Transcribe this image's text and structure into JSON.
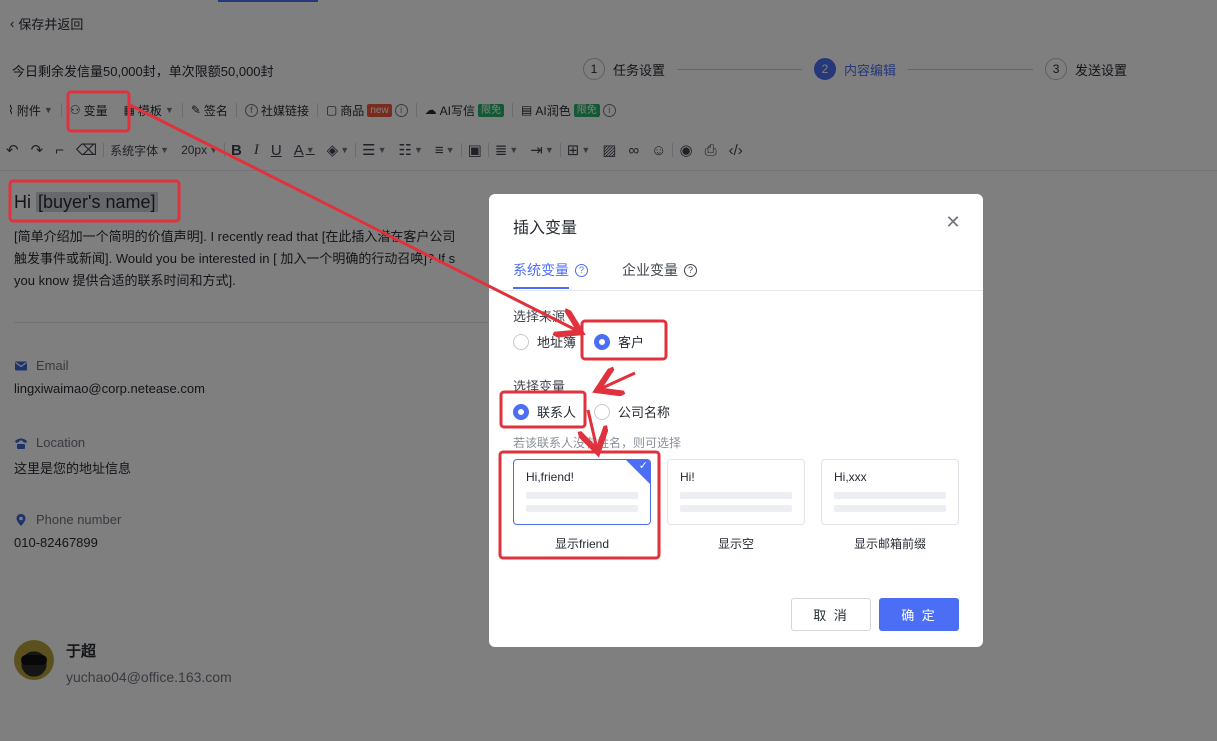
{
  "header": {
    "back_label": "保存并返回",
    "quota": "今日剩余发信量50,000封，单次限额50,000封"
  },
  "steps": [
    {
      "num": "1",
      "label": "任务设置"
    },
    {
      "num": "2",
      "label": "内容编辑"
    },
    {
      "num": "3",
      "label": "发送设置"
    }
  ],
  "toolbar1": {
    "attachment": "附件",
    "variable": "变量",
    "template": "模板",
    "signature": "签名",
    "social_link": "社媒链接",
    "product": "商品",
    "new_tag": "new",
    "ai_write": "AI写信",
    "ai_polish": "AI润色",
    "free_tag": "限免"
  },
  "toolbar2": {
    "font_family": "系统字体",
    "font_size": "20px"
  },
  "email": {
    "greeting_prefix": "Hi ",
    "greeting_var": "[buyer's name]",
    "body_lines": [
      "[简单介绍加一个简明的价值声明]. I recently read that [在此插入潜在客户公司",
      "触发事件或新闻]. Would you be interested in [ 加入一个明确的行动召唤]? If s",
      "you know 提供合适的联系时间和方式]."
    ]
  },
  "contacts": {
    "email_label": "Email",
    "email_value": "lingxiwaimao@corp.netease.com",
    "location_label": "Location",
    "location_value": "这里是您的地址信息",
    "phone_label": "Phone number",
    "phone_value": "010-82467899"
  },
  "author": {
    "name": "于超",
    "email": "yuchao04@office.163.com"
  },
  "dialog": {
    "title": "插入变量",
    "tabs": [
      "系统变量",
      "企业变量"
    ],
    "source_label": "选择来源",
    "source_options": [
      "地址簿",
      "客户"
    ],
    "variable_label": "选择变量",
    "variable_options": [
      "联系人",
      "公司名称"
    ],
    "hint": "若该联系人没有姓名，则可选择",
    "cards": [
      {
        "text": "Hi,friend!",
        "caption": "显示friend"
      },
      {
        "text": "Hi!",
        "caption": "显示空"
      },
      {
        "text": "Hi,xxx",
        "caption": "显示邮箱前缀"
      }
    ],
    "cancel": "取 消",
    "ok": "确 定"
  },
  "colors": {
    "accent": "#4c6ef5",
    "annotation": "#e0323c",
    "new_tag": "#f0593e",
    "free_tag": "#29b36d"
  }
}
